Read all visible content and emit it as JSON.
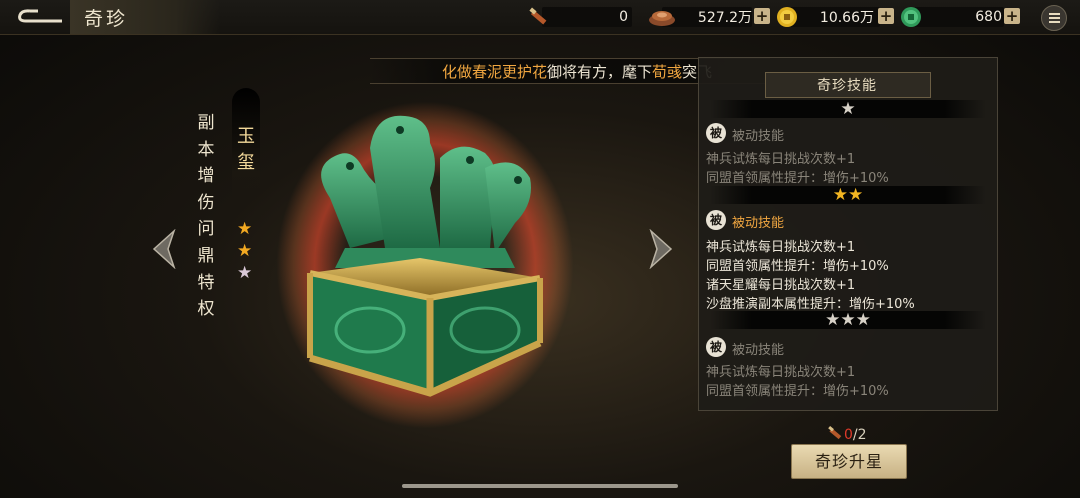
{
  "header": {
    "title": "奇珍",
    "resources": [
      {
        "icon": "scroll-token-icon",
        "value": "0"
      },
      {
        "icon": "copper-ingot-icon",
        "value": "527.2万"
      },
      {
        "icon": "gold-coin-icon",
        "value": "10.66万"
      },
      {
        "icon": "jade-coin-icon",
        "value": "680"
      }
    ],
    "plus": "+"
  },
  "banner": {
    "part1": "化做春泥更护花",
    "part2": "御将有方，麾下",
    "part3": "荀彧",
    "part4": "突飞"
  },
  "item": {
    "category_vertical": [
      "副",
      "本",
      "增",
      "伤",
      "问",
      "鼎",
      "特",
      "权"
    ],
    "name_vertical": [
      "玉",
      "玺"
    ],
    "stars": [
      {
        "glyph": "★",
        "color": "#f2a922"
      },
      {
        "glyph": "★",
        "color": "#f2a922"
      },
      {
        "glyph": "★",
        "color": "#d9c8d6"
      }
    ]
  },
  "panel": {
    "title": "奇珍技能",
    "tiers": [
      {
        "stars": "★",
        "badge": "被",
        "label": "被动技能",
        "active": false,
        "lines": [
          "神兵试炼每日挑战次数+1",
          "同盟首领属性提升：增伤+10%"
        ]
      },
      {
        "stars": "★★",
        "badge": "被",
        "label": "被动技能",
        "active": true,
        "lines": [
          "神兵试炼每日挑战次数+1",
          "同盟首领属性提升：增伤+10%",
          "诸天星耀每日挑战次数+1",
          "沙盘推演副本属性提升：增伤+10%"
        ]
      },
      {
        "stars": "★★★",
        "badge": "被",
        "label": "被动技能",
        "active": false,
        "lines": [
          "神兵试炼每日挑战次数+1",
          "同盟首领属性提升：增伤+10%"
        ]
      }
    ]
  },
  "upgrade": {
    "cost_have": "0",
    "cost_need": "/2",
    "button": "奇珍升星"
  },
  "colors": {
    "accent": "#f0a640",
    "star_gold": "#f2a922",
    "panel_bg": "#1e1c18"
  }
}
